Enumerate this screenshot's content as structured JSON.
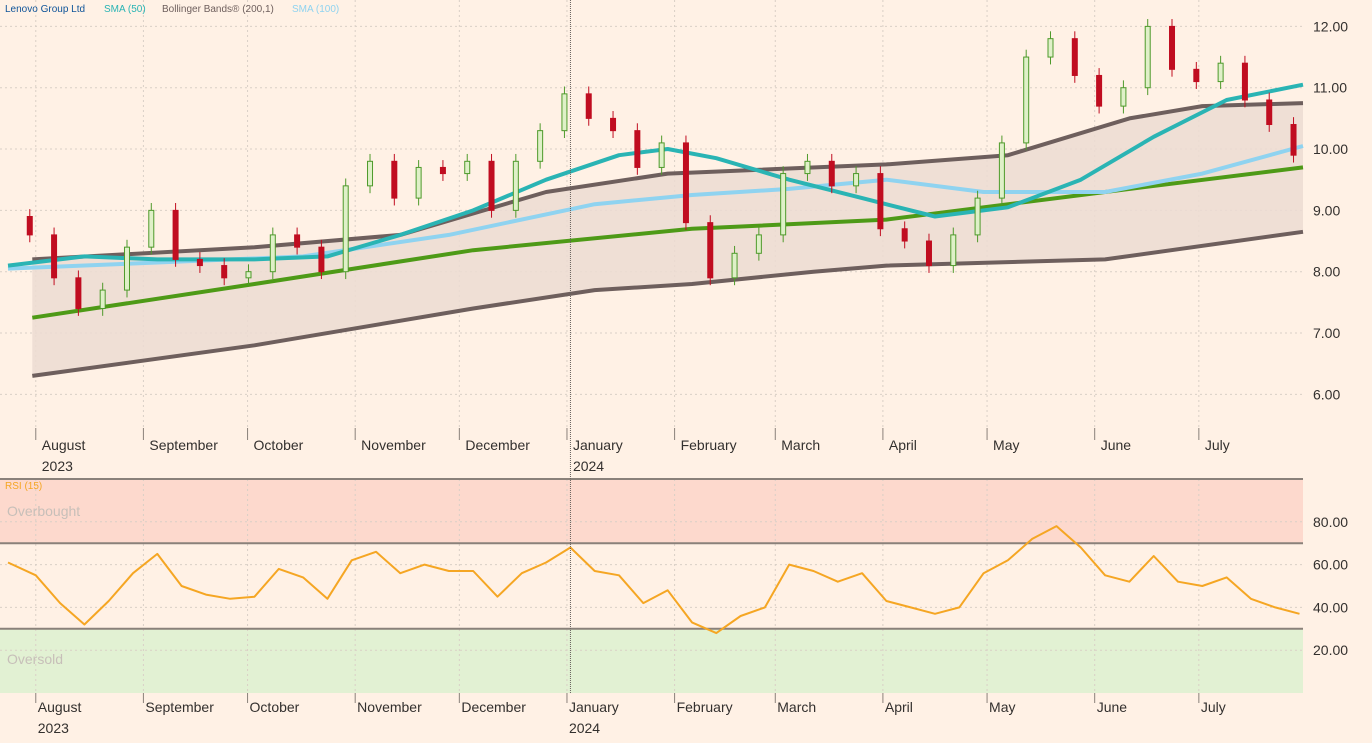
{
  "chart_data": [
    {
      "type": "candlestick",
      "title": "Lenovo Group Ltd",
      "legend": [
        {
          "label": "Lenovo Group Ltd",
          "color": "#0f5499"
        },
        {
          "label": "SMA (50)",
          "color": "#2ab4b4"
        },
        {
          "label": "Bollinger Bands® (200,1)",
          "color": "#6e5f5d"
        },
        {
          "label": "SMA (100)",
          "color": "#8fd3f0"
        }
      ],
      "ylim": [
        5.5,
        12.3
      ],
      "yticks": [
        "12.00",
        "11.00",
        "10.00",
        "9.00",
        "8.00",
        "7.00",
        "6.00"
      ],
      "ytick_values": [
        12,
        11,
        10,
        9,
        8,
        7,
        6
      ],
      "grid": true,
      "x_range": [
        "2023-07-24",
        "2024-07-31"
      ],
      "months": [
        {
          "label": "August",
          "year": "2023",
          "date": "2023-08-01"
        },
        {
          "label": "September",
          "year": "",
          "date": "2023-09-01"
        },
        {
          "label": "October",
          "year": "",
          "date": "2023-10-01"
        },
        {
          "label": "November",
          "year": "",
          "date": "2023-11-01"
        },
        {
          "label": "December",
          "year": "",
          "date": "2023-12-01"
        },
        {
          "label": "January",
          "year": "2024",
          "date": "2024-01-01"
        },
        {
          "label": "February",
          "year": "",
          "date": "2024-02-01"
        },
        {
          "label": "March",
          "year": "",
          "date": "2024-03-01"
        },
        {
          "label": "April",
          "year": "",
          "date": "2024-04-01"
        },
        {
          "label": "May",
          "year": "",
          "date": "2024-05-01"
        },
        {
          "label": "June",
          "year": "",
          "date": "2024-06-01"
        },
        {
          "label": "July",
          "year": "",
          "date": "2024-07-01"
        }
      ],
      "close": [
        {
          "date": "2023-07-24",
          "value": 8.9
        },
        {
          "date": "2023-08-01",
          "value": 8.6
        },
        {
          "date": "2023-08-08",
          "value": 7.9
        },
        {
          "date": "2023-08-15",
          "value": 7.4
        },
        {
          "date": "2023-08-22",
          "value": 7.7
        },
        {
          "date": "2023-08-29",
          "value": 8.4
        },
        {
          "date": "2023-09-05",
          "value": 9.0
        },
        {
          "date": "2023-09-12",
          "value": 8.2
        },
        {
          "date": "2023-09-19",
          "value": 8.1
        },
        {
          "date": "2023-09-26",
          "value": 7.9
        },
        {
          "date": "2023-10-03",
          "value": 8.0
        },
        {
          "date": "2023-10-10",
          "value": 8.6
        },
        {
          "date": "2023-10-17",
          "value": 8.4
        },
        {
          "date": "2023-10-24",
          "value": 8.0
        },
        {
          "date": "2023-10-31",
          "value": 9.4
        },
        {
          "date": "2023-11-07",
          "value": 9.8
        },
        {
          "date": "2023-11-14",
          "value": 9.2
        },
        {
          "date": "2023-11-21",
          "value": 9.7
        },
        {
          "date": "2023-11-28",
          "value": 9.6
        },
        {
          "date": "2023-12-05",
          "value": 9.8
        },
        {
          "date": "2023-12-12",
          "value": 9.0
        },
        {
          "date": "2023-12-19",
          "value": 9.8
        },
        {
          "date": "2023-12-26",
          "value": 10.3
        },
        {
          "date": "2024-01-02",
          "value": 10.9
        },
        {
          "date": "2024-01-09",
          "value": 10.5
        },
        {
          "date": "2024-01-16",
          "value": 10.3
        },
        {
          "date": "2024-01-23",
          "value": 9.7
        },
        {
          "date": "2024-01-30",
          "value": 10.1
        },
        {
          "date": "2024-02-06",
          "value": 8.8
        },
        {
          "date": "2024-02-13",
          "value": 7.9
        },
        {
          "date": "2024-02-20",
          "value": 8.3
        },
        {
          "date": "2024-02-27",
          "value": 8.6
        },
        {
          "date": "2024-03-05",
          "value": 9.6
        },
        {
          "date": "2024-03-12",
          "value": 9.8
        },
        {
          "date": "2024-03-19",
          "value": 9.4
        },
        {
          "date": "2024-03-26",
          "value": 9.6
        },
        {
          "date": "2024-04-02",
          "value": 8.7
        },
        {
          "date": "2024-04-09",
          "value": 8.5
        },
        {
          "date": "2024-04-16",
          "value": 8.1
        },
        {
          "date": "2024-04-23",
          "value": 8.6
        },
        {
          "date": "2024-04-30",
          "value": 9.2
        },
        {
          "date": "2024-05-07",
          "value": 10.1
        },
        {
          "date": "2024-05-14",
          "value": 11.5
        },
        {
          "date": "2024-05-21",
          "value": 11.8
        },
        {
          "date": "2024-05-28",
          "value": 11.2
        },
        {
          "date": "2024-06-04",
          "value": 10.7
        },
        {
          "date": "2024-06-11",
          "value": 11.0
        },
        {
          "date": "2024-06-18",
          "value": 12.0
        },
        {
          "date": "2024-06-25",
          "value": 11.3
        },
        {
          "date": "2024-07-02",
          "value": 11.1
        },
        {
          "date": "2024-07-09",
          "value": 11.4
        },
        {
          "date": "2024-07-16",
          "value": 10.8
        },
        {
          "date": "2024-07-23",
          "value": 10.4
        },
        {
          "date": "2024-07-30",
          "value": 9.9
        }
      ],
      "sma50": [
        {
          "date": "2023-07-24",
          "value": 8.1
        },
        {
          "date": "2023-08-15",
          "value": 8.25
        },
        {
          "date": "2023-09-05",
          "value": 8.2
        },
        {
          "date": "2023-10-03",
          "value": 8.2
        },
        {
          "date": "2023-10-24",
          "value": 8.25
        },
        {
          "date": "2023-11-14",
          "value": 8.6
        },
        {
          "date": "2023-12-05",
          "value": 9.0
        },
        {
          "date": "2023-12-26",
          "value": 9.5
        },
        {
          "date": "2024-01-16",
          "value": 9.9
        },
        {
          "date": "2024-01-30",
          "value": 10.0
        },
        {
          "date": "2024-02-13",
          "value": 9.85
        },
        {
          "date": "2024-03-05",
          "value": 9.5
        },
        {
          "date": "2024-03-26",
          "value": 9.2
        },
        {
          "date": "2024-04-16",
          "value": 8.9
        },
        {
          "date": "2024-05-07",
          "value": 9.05
        },
        {
          "date": "2024-05-28",
          "value": 9.5
        },
        {
          "date": "2024-06-18",
          "value": 10.2
        },
        {
          "date": "2024-07-09",
          "value": 10.8
        },
        {
          "date": "2024-07-31",
          "value": 11.05
        }
      ],
      "sma100": [
        {
          "date": "2023-07-24",
          "value": 8.05
        },
        {
          "date": "2023-09-05",
          "value": 8.15
        },
        {
          "date": "2023-10-17",
          "value": 8.25
        },
        {
          "date": "2023-11-28",
          "value": 8.6
        },
        {
          "date": "2024-01-09",
          "value": 9.1
        },
        {
          "date": "2024-02-06",
          "value": 9.25
        },
        {
          "date": "2024-03-05",
          "value": 9.35
        },
        {
          "date": "2024-04-02",
          "value": 9.5
        },
        {
          "date": "2024-04-30",
          "value": 9.3
        },
        {
          "date": "2024-06-04",
          "value": 9.3
        },
        {
          "date": "2024-07-02",
          "value": 9.6
        },
        {
          "date": "2024-07-31",
          "value": 10.05
        }
      ],
      "bb_middle": [
        {
          "date": "2023-07-31",
          "value": 7.25
        },
        {
          "date": "2023-10-03",
          "value": 7.8
        },
        {
          "date": "2023-12-05",
          "value": 8.35
        },
        {
          "date": "2024-02-06",
          "value": 8.7
        },
        {
          "date": "2024-04-02",
          "value": 8.85
        },
        {
          "date": "2024-06-04",
          "value": 9.3
        },
        {
          "date": "2024-07-31",
          "value": 9.7
        }
      ],
      "bb_upper": [
        {
          "date": "2023-07-31",
          "value": 8.2
        },
        {
          "date": "2023-10-03",
          "value": 8.4
        },
        {
          "date": "2023-11-14",
          "value": 8.6
        },
        {
          "date": "2023-12-26",
          "value": 9.3
        },
        {
          "date": "2024-01-30",
          "value": 9.6
        },
        {
          "date": "2024-04-02",
          "value": 9.75
        },
        {
          "date": "2024-05-07",
          "value": 9.9
        },
        {
          "date": "2024-06-11",
          "value": 10.5
        },
        {
          "date": "2024-07-02",
          "value": 10.7
        },
        {
          "date": "2024-07-31",
          "value": 10.75
        }
      ],
      "bb_lower": [
        {
          "date": "2023-07-31",
          "value": 6.3
        },
        {
          "date": "2023-10-03",
          "value": 6.8
        },
        {
          "date": "2023-12-05",
          "value": 7.4
        },
        {
          "date": "2024-01-09",
          "value": 7.7
        },
        {
          "date": "2024-02-06",
          "value": 7.8
        },
        {
          "date": "2024-03-12",
          "value": 8.0
        },
        {
          "date": "2024-04-02",
          "value": 8.1
        },
        {
          "date": "2024-06-04",
          "value": 8.2
        },
        {
          "date": "2024-07-31",
          "value": 8.65
        }
      ]
    },
    {
      "type": "line",
      "title": "RSI (15)",
      "ylim": [
        0,
        100
      ],
      "yticks": [
        "80.00",
        "60.00",
        "40.00",
        "20.00"
      ],
      "ytick_values": [
        80,
        60,
        40,
        20
      ],
      "overbought": {
        "label": "Overbought",
        "level": 70
      },
      "oversold": {
        "label": "Oversold",
        "level": 30
      },
      "series": [
        {
          "values": [
            {
              "date": "2023-07-24",
              "value": 61
            },
            {
              "date": "2023-08-01",
              "value": 55
            },
            {
              "date": "2023-08-08",
              "value": 42
            },
            {
              "date": "2023-08-15",
              "value": 32
            },
            {
              "date": "2023-08-22",
              "value": 43
            },
            {
              "date": "2023-08-29",
              "value": 56
            },
            {
              "date": "2023-09-05",
              "value": 65
            },
            {
              "date": "2023-09-12",
              "value": 50
            },
            {
              "date": "2023-09-19",
              "value": 46
            },
            {
              "date": "2023-09-26",
              "value": 44
            },
            {
              "date": "2023-10-03",
              "value": 45
            },
            {
              "date": "2023-10-10",
              "value": 58
            },
            {
              "date": "2023-10-17",
              "value": 54
            },
            {
              "date": "2023-10-24",
              "value": 44
            },
            {
              "date": "2023-10-31",
              "value": 62
            },
            {
              "date": "2023-11-07",
              "value": 66
            },
            {
              "date": "2023-11-14",
              "value": 56
            },
            {
              "date": "2023-11-21",
              "value": 60
            },
            {
              "date": "2023-11-28",
              "value": 57
            },
            {
              "date": "2023-12-05",
              "value": 57
            },
            {
              "date": "2023-12-12",
              "value": 45
            },
            {
              "date": "2023-12-19",
              "value": 56
            },
            {
              "date": "2023-12-26",
              "value": 61
            },
            {
              "date": "2024-01-02",
              "value": 68
            },
            {
              "date": "2024-01-09",
              "value": 57
            },
            {
              "date": "2024-01-16",
              "value": 55
            },
            {
              "date": "2024-01-23",
              "value": 42
            },
            {
              "date": "2024-01-30",
              "value": 48
            },
            {
              "date": "2024-02-06",
              "value": 33
            },
            {
              "date": "2024-02-13",
              "value": 28
            },
            {
              "date": "2024-02-20",
              "value": 36
            },
            {
              "date": "2024-02-27",
              "value": 40
            },
            {
              "date": "2024-03-05",
              "value": 60
            },
            {
              "date": "2024-03-12",
              "value": 57
            },
            {
              "date": "2024-03-19",
              "value": 52
            },
            {
              "date": "2024-03-26",
              "value": 56
            },
            {
              "date": "2024-04-02",
              "value": 43
            },
            {
              "date": "2024-04-09",
              "value": 40
            },
            {
              "date": "2024-04-16",
              "value": 37
            },
            {
              "date": "2024-04-23",
              "value": 40
            },
            {
              "date": "2024-04-30",
              "value": 56
            },
            {
              "date": "2024-05-07",
              "value": 62
            },
            {
              "date": "2024-05-14",
              "value": 72
            },
            {
              "date": "2024-05-21",
              "value": 78
            },
            {
              "date": "2024-05-28",
              "value": 68
            },
            {
              "date": "2024-06-04",
              "value": 55
            },
            {
              "date": "2024-06-11",
              "value": 52
            },
            {
              "date": "2024-06-18",
              "value": 64
            },
            {
              "date": "2024-06-25",
              "value": 52
            },
            {
              "date": "2024-07-02",
              "value": 50
            },
            {
              "date": "2024-07-09",
              "value": 54
            },
            {
              "date": "2024-07-16",
              "value": 44
            },
            {
              "date": "2024-07-23",
              "value": 40
            },
            {
              "date": "2024-07-30",
              "value": 37
            }
          ]
        }
      ]
    }
  ],
  "colors": {
    "background": "#fff1e5",
    "grid": "#d9cfc6",
    "up": "#4e9a2b",
    "down": "#c00d20",
    "sma50": "#2ab4b4",
    "sma100": "#8fd3f0",
    "bb_band": "#6e5f5d",
    "bb_middle": "#4e9a17",
    "bb_fill": "#ecdcd2",
    "rsi": "#f5a623",
    "overbought_fill": "#fdd9cd",
    "oversold_fill": "#e2f1d3",
    "axis_text": "#33302e"
  }
}
